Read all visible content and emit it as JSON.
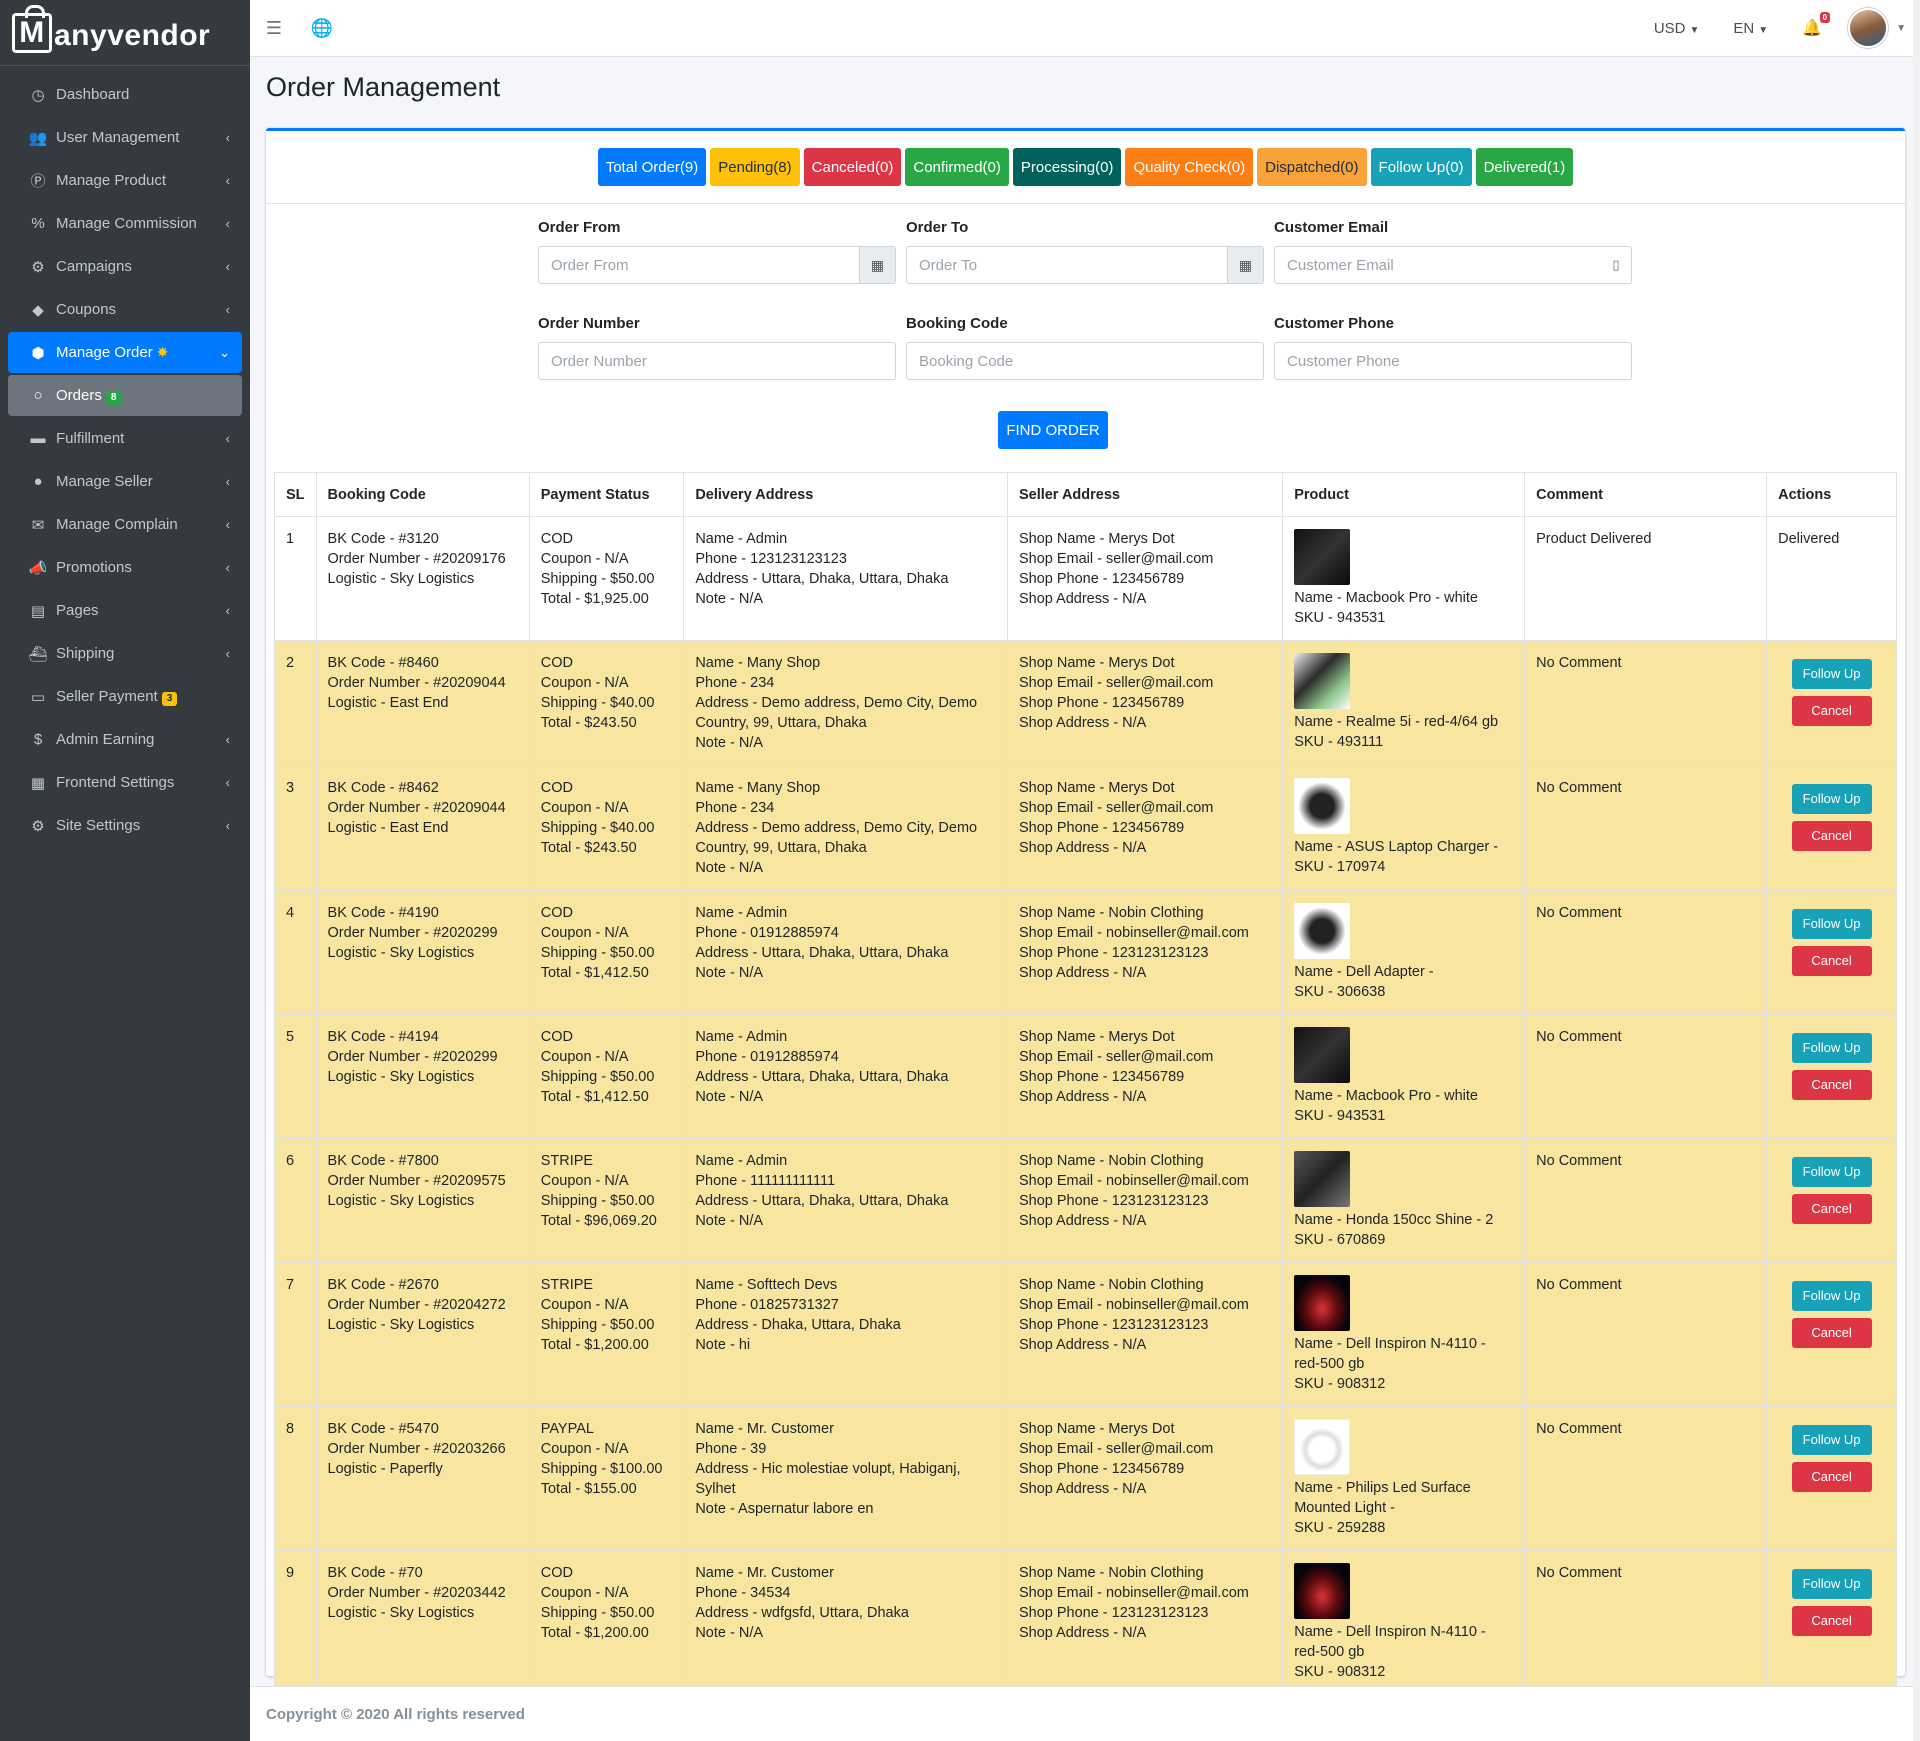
{
  "brand": {
    "name": "Manyvendor",
    "logo_letter": "M",
    "logo_rest": "anyvendor"
  },
  "sidebar": {
    "items": [
      {
        "label": "Dashboard",
        "icon": "dashboard-icon",
        "glyph": "◷"
      },
      {
        "label": "User Management",
        "icon": "users-icon",
        "glyph": "👥"
      },
      {
        "label": "Manage Product",
        "icon": "product-icon",
        "glyph": "Ⓟ"
      },
      {
        "label": "Manage Commission",
        "icon": "percent-icon",
        "glyph": "%"
      },
      {
        "label": "Campaigns",
        "icon": "campaign-icon",
        "glyph": "⚙"
      },
      {
        "label": "Coupons",
        "icon": "tag-icon",
        "glyph": "◆"
      },
      {
        "label": "Manage Order",
        "icon": "cube-icon",
        "glyph": "⬢"
      },
      {
        "label": "Orders",
        "icon": "circle-icon",
        "glyph": "○",
        "badge": "8"
      },
      {
        "label": "Fulfillment",
        "icon": "truck-icon",
        "glyph": "▬"
      },
      {
        "label": "Manage Seller",
        "icon": "user-icon",
        "glyph": "●"
      },
      {
        "label": "Manage Complain",
        "icon": "complain-icon",
        "glyph": "✉"
      },
      {
        "label": "Promotions",
        "icon": "bullhorn-icon",
        "glyph": "📣"
      },
      {
        "label": "Pages",
        "icon": "page-icon",
        "glyph": "▤"
      },
      {
        "label": "Shipping",
        "icon": "ship-icon",
        "glyph": "⛴"
      },
      {
        "label": "Seller Payment",
        "icon": "payment-icon",
        "glyph": "▭",
        "badge": "3"
      },
      {
        "label": "Admin Earning",
        "icon": "dollar-icon",
        "glyph": "$"
      },
      {
        "label": "Frontend Settings",
        "icon": "frontend-icon",
        "glyph": "▦"
      },
      {
        "label": "Site Settings",
        "icon": "cogs-icon",
        "glyph": "⚙"
      }
    ]
  },
  "topbar": {
    "currency": "USD",
    "language": "EN",
    "notifications": "0"
  },
  "page": {
    "title": "Order Management"
  },
  "status_tabs": [
    {
      "label": "Total Order(9)"
    },
    {
      "label": "Pending(8)"
    },
    {
      "label": "Canceled(0)"
    },
    {
      "label": "Confirmed(0)"
    },
    {
      "label": "Processing(0)"
    },
    {
      "label": "Quality Check(0)"
    },
    {
      "label": "Dispatched(0)"
    },
    {
      "label": "Follow Up(0)"
    },
    {
      "label": "Delivered(1)"
    }
  ],
  "filters": {
    "order_from": {
      "label": "Order From",
      "placeholder": "Order From"
    },
    "order_to": {
      "label": "Order To",
      "placeholder": "Order To"
    },
    "customer_email": {
      "label": "Customer Email",
      "placeholder": "Customer Email"
    },
    "order_number": {
      "label": "Order Number",
      "placeholder": "Order Number"
    },
    "booking_code": {
      "label": "Booking Code",
      "placeholder": "Booking Code"
    },
    "customer_phone": {
      "label": "Customer Phone",
      "placeholder": "Customer Phone"
    },
    "find_label": "FIND ORDER"
  },
  "table": {
    "headers": [
      "SL",
      "Booking Code",
      "Payment Status",
      "Delivery Address",
      "Seller Address",
      "Product",
      "Comment",
      "Actions"
    ],
    "follow_label": "Follow Up",
    "cancel_label": "Cancel",
    "rows": [
      {
        "sl": "1",
        "booking": [
          "BK Code - #3120",
          "Order Number - #20209176",
          "Logistic - Sky Logistics"
        ],
        "payment": [
          "COD",
          "Coupon - N/A",
          "Shipping - $50.00",
          "Total - $1,925.00"
        ],
        "delivery": [
          "Name - Admin",
          "Phone - 123123123123",
          "Address - Uttara, Dhaka, Uttara, Dhaka",
          "Note - N/A"
        ],
        "seller": [
          "Shop Name - Merys Dot",
          "Shop Email - seller@mail.com",
          "Shop Phone - 123456789",
          "Shop Address - N/A"
        ],
        "product_img": "dark",
        "product": [
          "Name - Macbook Pro - white",
          "SKU - 943531"
        ],
        "comment": "Product Delivered",
        "action_text": "Delivered"
      },
      {
        "sl": "2",
        "booking": [
          "BK Code - #8460",
          "Order Number - #20209044",
          "Logistic - East End"
        ],
        "payment": [
          "COD",
          "Coupon - N/A",
          "Shipping - $40.00",
          "Total - $243.50"
        ],
        "delivery": [
          "Name - Many Shop",
          "Phone - 234",
          "Address - Demo address, Demo City, Demo",
          "Country, 99, Uttara, Dhaka",
          "Note - N/A"
        ],
        "seller": [
          "Shop Name - Merys Dot",
          "Shop Email - seller@mail.com",
          "Shop Phone - 123456789",
          "Shop Address - N/A"
        ],
        "product_img": "phone",
        "product": [
          "Name - Realme 5i - red-4/64 gb",
          "SKU - 493111"
        ],
        "comment": "No Comment",
        "action_text": ""
      },
      {
        "sl": "3",
        "booking": [
          "BK Code - #8462",
          "Order Number - #20209044",
          "Logistic - East End"
        ],
        "payment": [
          "COD",
          "Coupon - N/A",
          "Shipping - $40.00",
          "Total - $243.50"
        ],
        "delivery": [
          "Name - Many Shop",
          "Phone - 234",
          "Address - Demo address, Demo City, Demo",
          "Country, 99, Uttara, Dhaka",
          "Note - N/A"
        ],
        "seller": [
          "Shop Name - Merys Dot",
          "Shop Email - seller@mail.com",
          "Shop Phone - 123456789",
          "Shop Address - N/A"
        ],
        "product_img": "charger",
        "product": [
          "Name - ASUS Laptop Charger -",
          "SKU - 170974"
        ],
        "comment": "No Comment",
        "action_text": ""
      },
      {
        "sl": "4",
        "booking": [
          "BK Code - #4190",
          "Order Number - #2020299",
          "Logistic - Sky Logistics"
        ],
        "payment": [
          "COD",
          "Coupon - N/A",
          "Shipping - $50.00",
          "Total - $1,412.50"
        ],
        "delivery": [
          "Name - Admin",
          "Phone - 01912885974",
          "Address - Uttara, Dhaka, Uttara, Dhaka",
          "Note - N/A"
        ],
        "seller": [
          "Shop Name - Nobin Clothing",
          "Shop Email - nobinseller@mail.com",
          "Shop Phone - 123123123123",
          "Shop Address - N/A"
        ],
        "product_img": "charger",
        "product": [
          "Name - Dell Adapter -",
          "SKU - 306638"
        ],
        "comment": "No Comment",
        "action_text": ""
      },
      {
        "sl": "5",
        "booking": [
          "BK Code - #4194",
          "Order Number - #2020299",
          "Logistic - Sky Logistics"
        ],
        "payment": [
          "COD",
          "Coupon - N/A",
          "Shipping - $50.00",
          "Total - $1,412.50"
        ],
        "delivery": [
          "Name - Admin",
          "Phone - 01912885974",
          "Address - Uttara, Dhaka, Uttara, Dhaka",
          "Note - N/A"
        ],
        "seller": [
          "Shop Name - Merys Dot",
          "Shop Email - seller@mail.com",
          "Shop Phone - 123456789",
          "Shop Address - N/A"
        ],
        "product_img": "dark",
        "product": [
          "Name - Macbook Pro - white",
          "SKU - 943531"
        ],
        "comment": "No Comment",
        "action_text": ""
      },
      {
        "sl": "6",
        "booking": [
          "BK Code - #7800",
          "Order Number - #20209575",
          "Logistic - Sky Logistics"
        ],
        "payment": [
          "STRIPE",
          "Coupon - N/A",
          "Shipping - $50.00",
          "Total - $96,069.20"
        ],
        "delivery": [
          "Name - Admin",
          "Phone - 111111111111",
          "Address - Uttara, Dhaka, Uttara, Dhaka",
          "Note - N/A"
        ],
        "seller": [
          "Shop Name - Nobin Clothing",
          "Shop Email - nobinseller@mail.com",
          "Shop Phone - 123123123123",
          "Shop Address - N/A"
        ],
        "product_img": "bike",
        "product": [
          "Name - Honda 150cc Shine - 2",
          "SKU - 670869"
        ],
        "comment": "No Comment",
        "action_text": ""
      },
      {
        "sl": "7",
        "booking": [
          "BK Code - #2670",
          "Order Number - #20204272",
          "Logistic - Sky Logistics"
        ],
        "payment": [
          "STRIPE",
          "Coupon - N/A",
          "Shipping - $50.00",
          "Total - $1,200.00"
        ],
        "delivery": [
          "Name - Softtech Devs",
          "Phone - 01825731327",
          "Address - Dhaka, Uttara, Dhaka",
          "Note - hi"
        ],
        "seller": [
          "Shop Name - Nobin Clothing",
          "Shop Email - nobinseller@mail.com",
          "Shop Phone - 123123123123",
          "Shop Address - N/A"
        ],
        "product_img": "redlap",
        "product": [
          "Name - Dell Inspiron N-4110 -",
          "red-500 gb",
          "SKU - 908312"
        ],
        "comment": "No Comment",
        "action_text": ""
      },
      {
        "sl": "8",
        "booking": [
          "BK Code - #5470",
          "Order Number - #20203266",
          "Logistic - Paperfly"
        ],
        "payment": [
          "PAYPAL",
          "Coupon - N/A",
          "Shipping - $100.00",
          "Total - $155.00"
        ],
        "delivery": [
          "Name - Mr. Customer",
          "Phone - 39",
          "Address - Hic molestiae volupt, Habiganj,",
          "Sylhet",
          "Note - Aspernatur labore en"
        ],
        "seller": [
          "Shop Name - Merys Dot",
          "Shop Email - seller@mail.com",
          "Shop Phone - 123456789",
          "Shop Address - N/A"
        ],
        "product_img": "light",
        "product": [
          "Name - Philips Led Surface",
          "Mounted Light -",
          "SKU - 259288"
        ],
        "comment": "No Comment",
        "action_text": ""
      },
      {
        "sl": "9",
        "booking": [
          "BK Code - #70",
          "Order Number - #20203442",
          "Logistic - Sky Logistics"
        ],
        "payment": [
          "COD",
          "Coupon - N/A",
          "Shipping - $50.00",
          "Total - $1,200.00"
        ],
        "delivery": [
          "Name - Mr. Customer",
          "Phone - 34534",
          "Address - wdfgsfd, Uttara, Dhaka",
          "Note - N/A"
        ],
        "seller": [
          "Shop Name - Nobin Clothing",
          "Shop Email - nobinseller@mail.com",
          "Shop Phone - 123123123123",
          "Shop Address - N/A"
        ],
        "product_img": "redlap",
        "product": [
          "Name - Dell Inspiron N-4110 -",
          "red-500 gb",
          "SKU - 908312"
        ],
        "comment": "No Comment",
        "action_text": ""
      }
    ]
  },
  "footer": {
    "text": "Copyright © 2020 All rights reserved"
  }
}
